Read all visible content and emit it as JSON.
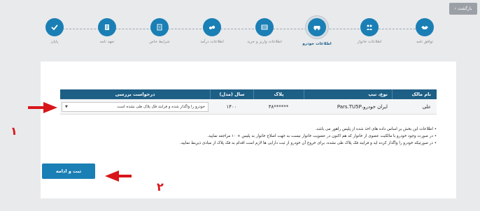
{
  "back_button": {
    "label": "بازگشت",
    "icon": "chevron-left-icon"
  },
  "steps": [
    {
      "label": "توافق نامه",
      "icon": "handshake-icon"
    },
    {
      "label": "اطلاعات خانوار",
      "icon": "family-icon"
    },
    {
      "label": "اطلاعات خودرو",
      "icon": "car-icon",
      "active": true
    },
    {
      "label": "اطلاعات واریز و خرید",
      "icon": "list-icon"
    },
    {
      "label": "اطلاعات درآمد",
      "icon": "money-icon"
    },
    {
      "label": "شرایط خاص",
      "icon": "conditions-icon"
    },
    {
      "label": "تعهد نامه",
      "icon": "document-icon"
    },
    {
      "label": "پایان",
      "icon": "check-icon"
    }
  ],
  "table": {
    "headers": [
      "نام مالک",
      "نوع، تیپ",
      "پلاک",
      "سال (مدل)",
      "درخواست بررسی"
    ],
    "rows": [
      {
        "owner": "علی",
        "type": "ایران خودرو،Pars.TU5P",
        "plate": "******۳۸",
        "year": "۱۴۰۰",
        "request": "خودرو را واگذار شده و فرایند فک پلاک طی نشده است"
      }
    ]
  },
  "notes": [
    "اطلاعات این بخش بر اساس داده های اخذ شده از پلیس راهور می باشد.",
    "در صورت وجود خودرو با مالکیت عضوی از خانوار که هم اکنون در عضویت خانوار نیست به جهت اصلاح خانوار به پلیس + ۱۰ مراجعه نمایید.",
    "در صورتیکه خودرو را واگذار کرده اید و فرایند فک پلاک طی نشده، برای خروج آن خودرو از ثبت دارایی ها لازم است اقدام به فک پلاک از مبادی ذیربط نمایید."
  ],
  "submit_button": {
    "label": "ثبت و ادامه"
  },
  "annotations": {
    "one": "۱",
    "two": "۲",
    "color": "#d8161a"
  },
  "colors": {
    "primary": "#1a7fb5",
    "header": "#1e5f86"
  }
}
